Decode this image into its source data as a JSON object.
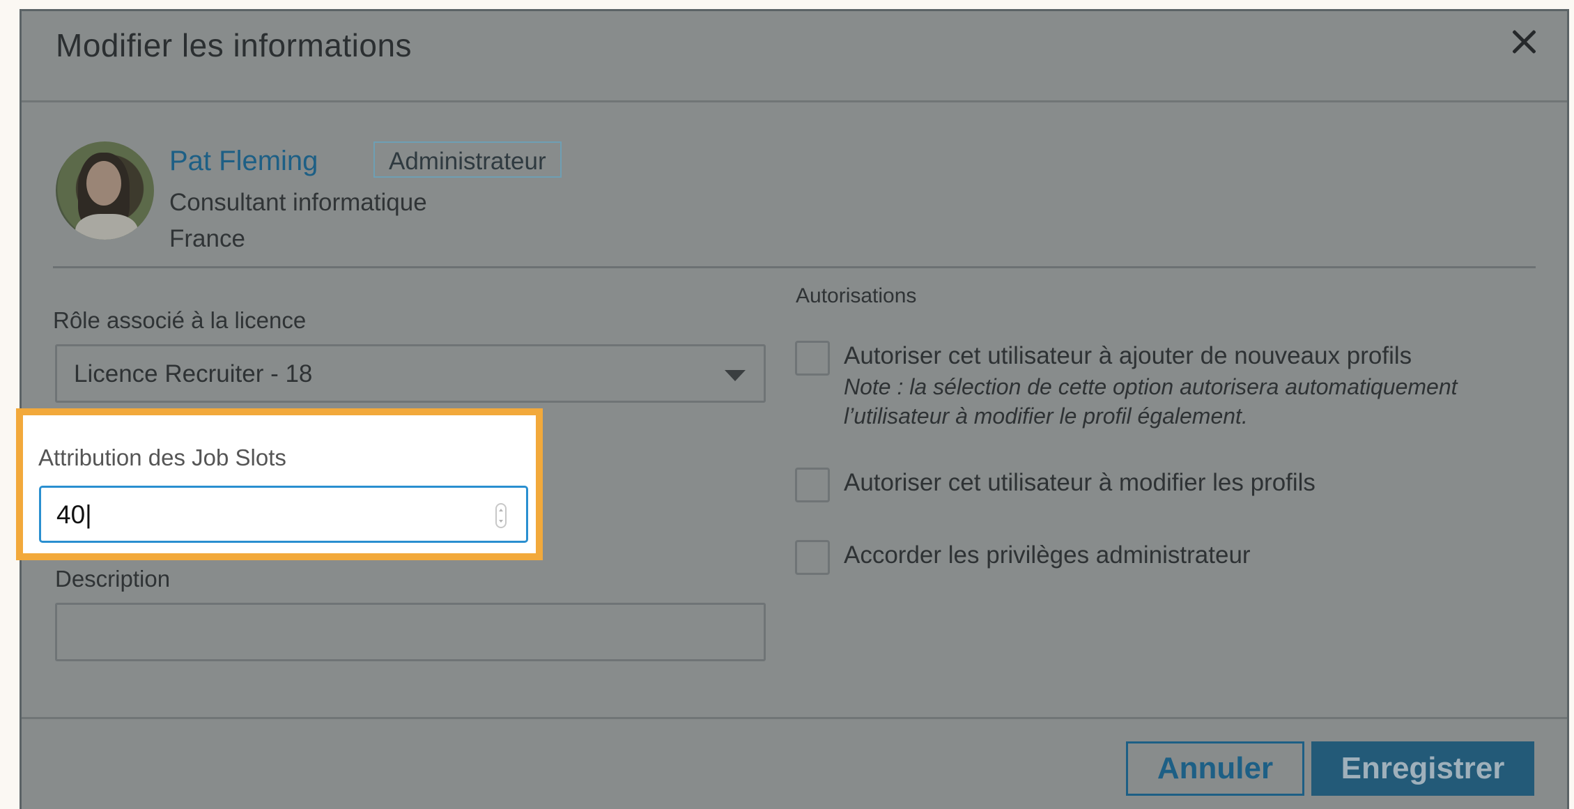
{
  "dialog": {
    "title": "Modifier les informations"
  },
  "profile": {
    "name": "Pat Fleming",
    "badge": "Administrateur",
    "job_title": "Consultant informatique",
    "country": "France"
  },
  "form": {
    "role_label": "Rôle associé à la licence",
    "role_value": "Licence Recruiter - 18",
    "job_slots_label": "Attribution des Job Slots",
    "job_slots_value": "40|",
    "description_label": "Description",
    "description_value": ""
  },
  "permissions": {
    "heading": "Autorisations",
    "items": [
      {
        "label": "Autoriser cet utilisateur à ajouter de nouveaux profils",
        "note_line1": "Note : la sélection de cette option autorisera automatiquement",
        "note_line2": "l’utilisateur à modifier le profil également.",
        "checked": false
      },
      {
        "label": "Autoriser cet utilisateur à modifier les profils",
        "checked": false
      },
      {
        "label": "Accorder les privilèges administrateur",
        "checked": false
      }
    ]
  },
  "footer": {
    "cancel_label": "Annuler",
    "save_label": "Enregistrer"
  },
  "colors": {
    "highlight": "#f2a93b",
    "link": "#1d5f85",
    "overlay": "#888c8c",
    "focus": "#2a8fd0"
  },
  "icons": [
    "close-icon",
    "chevron-down-icon",
    "stepper-icon",
    "avatar"
  ]
}
